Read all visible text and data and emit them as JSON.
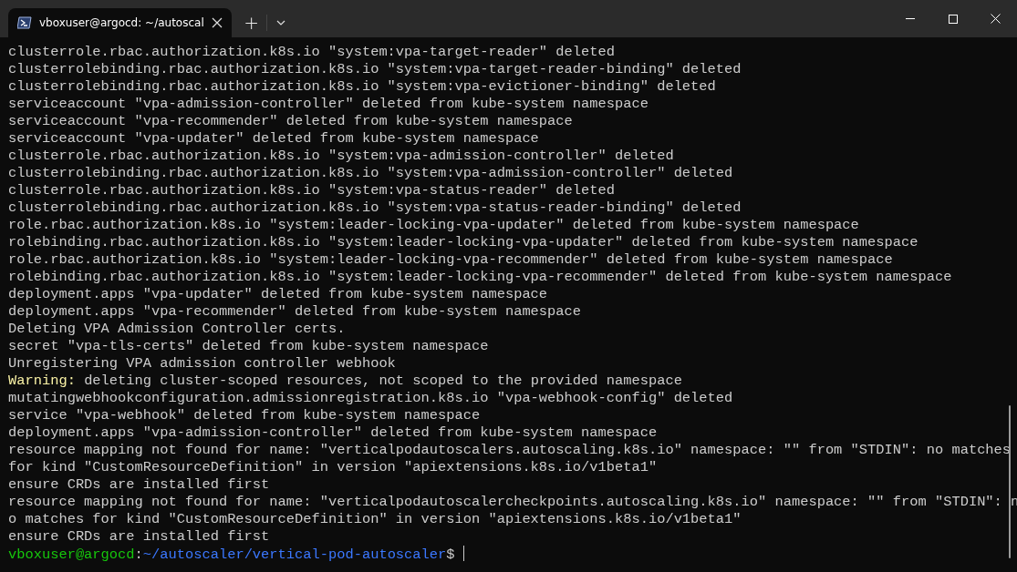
{
  "window": {
    "tab_title": "vboxuser@argocd: ~/autoscal",
    "new_tab": "+"
  },
  "lines": [
    {
      "kind": "plain",
      "text": "clusterrole.rbac.authorization.k8s.io \"system:vpa-target-reader\" deleted"
    },
    {
      "kind": "plain",
      "text": "clusterrolebinding.rbac.authorization.k8s.io \"system:vpa-target-reader-binding\" deleted"
    },
    {
      "kind": "plain",
      "text": "clusterrolebinding.rbac.authorization.k8s.io \"system:vpa-evictioner-binding\" deleted"
    },
    {
      "kind": "plain",
      "text": "serviceaccount \"vpa-admission-controller\" deleted from kube-system namespace"
    },
    {
      "kind": "plain",
      "text": "serviceaccount \"vpa-recommender\" deleted from kube-system namespace"
    },
    {
      "kind": "plain",
      "text": "serviceaccount \"vpa-updater\" deleted from kube-system namespace"
    },
    {
      "kind": "plain",
      "text": "clusterrole.rbac.authorization.k8s.io \"system:vpa-admission-controller\" deleted"
    },
    {
      "kind": "plain",
      "text": "clusterrolebinding.rbac.authorization.k8s.io \"system:vpa-admission-controller\" deleted"
    },
    {
      "kind": "plain",
      "text": "clusterrole.rbac.authorization.k8s.io \"system:vpa-status-reader\" deleted"
    },
    {
      "kind": "plain",
      "text": "clusterrolebinding.rbac.authorization.k8s.io \"system:vpa-status-reader-binding\" deleted"
    },
    {
      "kind": "plain",
      "text": "role.rbac.authorization.k8s.io \"system:leader-locking-vpa-updater\" deleted from kube-system namespace"
    },
    {
      "kind": "plain",
      "text": "rolebinding.rbac.authorization.k8s.io \"system:leader-locking-vpa-updater\" deleted from kube-system namespace"
    },
    {
      "kind": "plain",
      "text": "role.rbac.authorization.k8s.io \"system:leader-locking-vpa-recommender\" deleted from kube-system namespace"
    },
    {
      "kind": "plain",
      "text": "rolebinding.rbac.authorization.k8s.io \"system:leader-locking-vpa-recommender\" deleted from kube-system namespace"
    },
    {
      "kind": "plain",
      "text": "deployment.apps \"vpa-updater\" deleted from kube-system namespace"
    },
    {
      "kind": "plain",
      "text": "deployment.apps \"vpa-recommender\" deleted from kube-system namespace"
    },
    {
      "kind": "plain",
      "text": "Deleting VPA Admission Controller certs."
    },
    {
      "kind": "plain",
      "text": "secret \"vpa-tls-certs\" deleted from kube-system namespace"
    },
    {
      "kind": "plain",
      "text": "Unregistering VPA admission controller webhook"
    },
    {
      "kind": "warning",
      "label": "Warning:",
      "text": " deleting cluster-scoped resources, not scoped to the provided namespace"
    },
    {
      "kind": "plain",
      "text": "mutatingwebhookconfiguration.admissionregistration.k8s.io \"vpa-webhook-config\" deleted"
    },
    {
      "kind": "plain",
      "text": "service \"vpa-webhook\" deleted from kube-system namespace"
    },
    {
      "kind": "plain",
      "text": "deployment.apps \"vpa-admission-controller\" deleted from kube-system namespace"
    },
    {
      "kind": "plain",
      "text": "resource mapping not found for name: \"verticalpodautoscalers.autoscaling.k8s.io\" namespace: \"\" from \"STDIN\": no matches"
    },
    {
      "kind": "plain",
      "text": "for kind \"CustomResourceDefinition\" in version \"apiextensions.k8s.io/v1beta1\""
    },
    {
      "kind": "plain",
      "text": "ensure CRDs are installed first"
    },
    {
      "kind": "plain",
      "text": "resource mapping not found for name: \"verticalpodautoscalercheckpoints.autoscaling.k8s.io\" namespace: \"\" from \"STDIN\": n"
    },
    {
      "kind": "plain",
      "text": "o matches for kind \"CustomResourceDefinition\" in version \"apiextensions.k8s.io/v1beta1\""
    },
    {
      "kind": "plain",
      "text": "ensure CRDs are installed first"
    },
    {
      "kind": "prompt",
      "user": "vboxuser@argocd",
      "sep": ":",
      "path": "~/autoscaler/vertical-pod-autoscaler",
      "symbol": "$"
    }
  ]
}
